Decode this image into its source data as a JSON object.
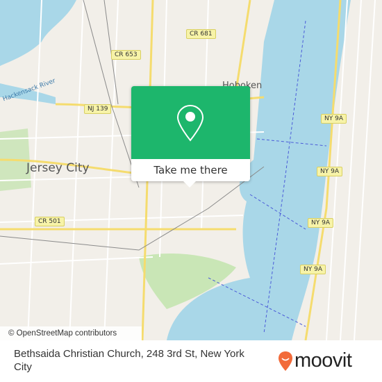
{
  "map": {
    "colors": {
      "land": "#f2efe9",
      "water": "#a9d7e8",
      "park": "#c9e6b6",
      "road_major": "#f5dc6e",
      "accent": "#1db66c"
    },
    "places": [
      "Hoboken",
      "Jersey City"
    ],
    "water_labels": [
      "Hackensack River"
    ],
    "shields": [
      "CR 681",
      "CR 653",
      "NJ 139",
      "CR 501",
      "NY 9A",
      "NY 9A",
      "NY 9A",
      "NY 9A"
    ]
  },
  "popup": {
    "icon": "map-pin-icon",
    "button_label": "Take me there"
  },
  "attribution": "© OpenStreetMap contributors",
  "footer": {
    "address": "Bethsaida Christian Church, 248 3rd St, New York City",
    "logo": "moovit",
    "logo_color": "#f26b3a"
  }
}
